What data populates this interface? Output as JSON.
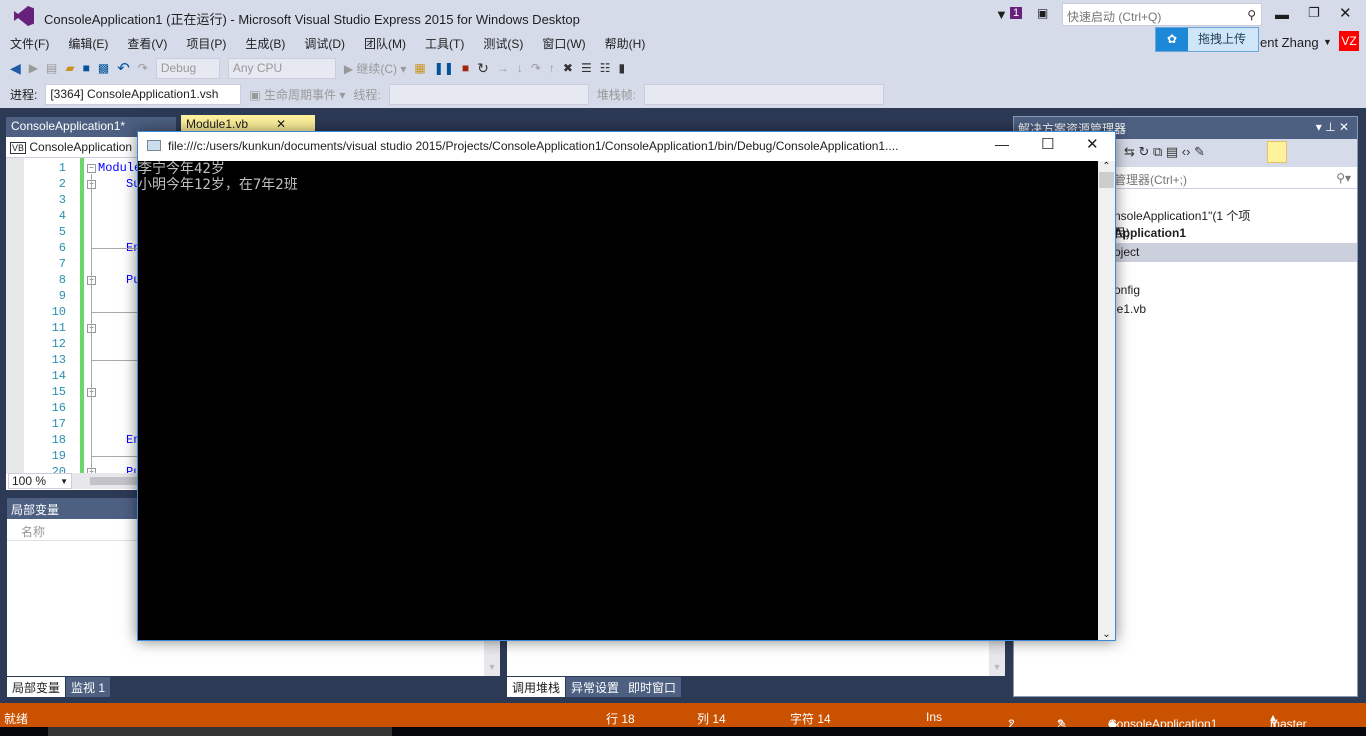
{
  "window": {
    "title": "ConsoleApplication1 (正在运行) - Microsoft Visual Studio Express 2015 for Windows Desktop",
    "notification_count": "1",
    "quick_launch_placeholder": "快速启动 (Ctrl+Q)",
    "user_name": "ent Zhang",
    "user_initials": "VZ",
    "upload_label": "拖拽上传"
  },
  "menu": [
    "文件(F)",
    "编辑(E)",
    "查看(V)",
    "项目(P)",
    "生成(B)",
    "调试(D)",
    "团队(M)",
    "工具(T)",
    "测试(S)",
    "窗口(W)",
    "帮助(H)"
  ],
  "toolbar": {
    "config": "Debug",
    "platform": "Any CPU",
    "continue": "继续(C)",
    "process_label": "进程:",
    "process": "[3364] ConsoleApplication1.vsh",
    "lifecycle": "生命周期事件",
    "thread_label": "线程:",
    "stackframe_label": "堆栈帧:"
  },
  "editor": {
    "tabs": [
      "ConsoleApplication1*",
      "Module1.vb"
    ],
    "nav_project": "ConsoleApplication",
    "zoom": "100 %",
    "line_numbers": [
      "1",
      "2",
      "3",
      "4",
      "5",
      "6",
      "7",
      "8",
      "9",
      "10",
      "11",
      "12",
      "13",
      "14",
      "15",
      "16",
      "17",
      "18",
      "19",
      "20"
    ],
    "code": {
      "l1": "Module",
      "l2": "Su",
      "l6": "En",
      "l8": "Pu",
      "l18": "En",
      "l20": "Pu"
    }
  },
  "console": {
    "title": "file:///c:/users/kunkun/documents/visual studio 2015/Projects/ConsoleApplication1/ConsoleApplication1/bin/Debug/ConsoleApplication1....",
    "lines": [
      "李宁今年42岁",
      "小明今年12岁，在7年2班"
    ]
  },
  "locals": {
    "title": "局部变量",
    "column": "名称",
    "tabs": [
      "局部变量",
      "监视 1"
    ]
  },
  "callstack": {
    "tabs": [
      "调用堆栈",
      "异常设置",
      "即时窗口"
    ]
  },
  "solution": {
    "title": "解决方案资源管理器",
    "search_placeholder": "管理器(Ctrl+;)",
    "items": [
      "nsoleApplication1\"(1 个项目)",
      "Application1",
      "oject",
      "onfig",
      "le1.vb"
    ]
  },
  "status": {
    "ready": "就绪",
    "row": "行 18",
    "col": "列 14",
    "char": "字符 14",
    "mode": "Ins",
    "push": "2",
    "edits": "2",
    "repo": "ConsoleApplication1",
    "branch": "master"
  },
  "colors": {
    "accent": "#68217a",
    "status_bar": "#ca5100",
    "console_bg": "#000000"
  }
}
